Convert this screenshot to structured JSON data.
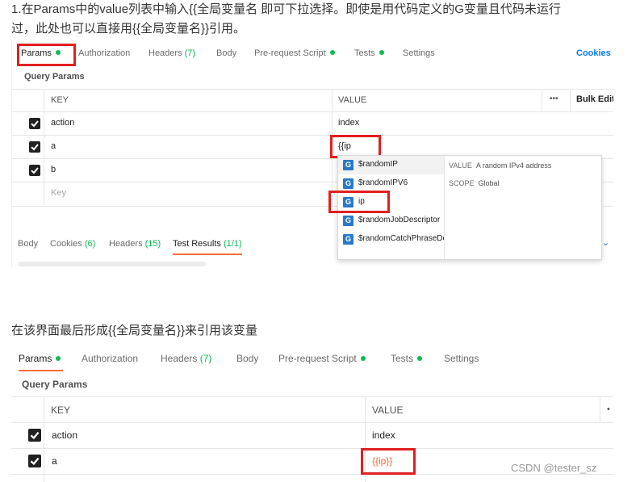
{
  "article": {
    "step1_line1": "1.在Params中的value列表中输入{{全局变量名 即可下拉选择。即使是用代码定义的G变量且代码未运行",
    "step1_line2": "过，此处也可以直接用{{全局变量名}}引用。",
    "step2": "在该界面最后形成{{全局变量名}}来引用该变量",
    "watermark": "CSDN @tester_sz"
  },
  "shot1": {
    "tabs": {
      "params": "Params",
      "authorization": "Authorization",
      "headers": "Headers",
      "headers_count": "(7)",
      "body": "Body",
      "prerequest": "Pre-request Script",
      "tests": "Tests",
      "settings": "Settings",
      "cookies": "Cookies"
    },
    "section_title": "Query Params",
    "table": {
      "key_header": "KEY",
      "value_header": "VALUE",
      "more_icon": "•••",
      "bulk_edit": "Bulk Edit",
      "rows": [
        {
          "key": "action",
          "value": "index"
        },
        {
          "key": "a",
          "value": "{{ip"
        },
        {
          "key": "b",
          "value": ""
        }
      ],
      "placeholder_key": "Key"
    },
    "autocomplete": {
      "items": [
        "$randomIP",
        "$randomIPV6",
        "ip",
        "$randomJobDescriptor",
        "$randomCatchPhraseDescriptor"
      ],
      "badge": "G",
      "value_label": "VALUE",
      "value_text": "A random IPv4 address",
      "scope_label": "SCOPE",
      "scope_text": "Global"
    },
    "response_tabs": {
      "body": "Body",
      "cookies": "Cookies",
      "cookies_count": "(6)",
      "headers": "Headers",
      "headers_count": "(15)",
      "test_results": "Test Results",
      "test_count": "(1/1)"
    },
    "colors": {
      "accent": "#ff6c37",
      "green": "#0cbb52",
      "blue": "#097bed",
      "red": "#e02020"
    }
  },
  "shot2": {
    "tabs": {
      "params": "Params",
      "authorization": "Authorization",
      "headers": "Headers",
      "headers_count": "(7)",
      "body": "Body",
      "prerequest": "Pre-request Script",
      "tests": "Tests",
      "settings": "Settings"
    },
    "section_title": "Query Params",
    "table": {
      "key_header": "KEY",
      "value_header": "VALUE",
      "rows": [
        {
          "key": "action",
          "value": "index"
        },
        {
          "key": "a",
          "value": "{{ip}}"
        }
      ]
    }
  }
}
